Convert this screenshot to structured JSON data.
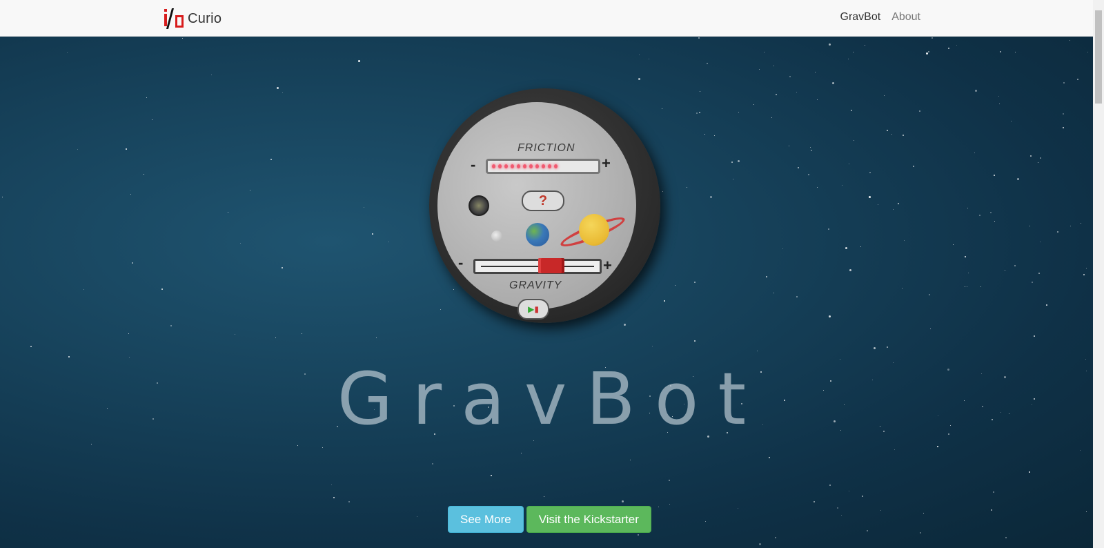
{
  "navbar": {
    "brand_name": "Curio",
    "links": [
      {
        "label": "GravBot",
        "active": true
      },
      {
        "label": "About",
        "active": false
      }
    ]
  },
  "hero": {
    "title": "GravBot",
    "device": {
      "friction_label": "FRICTION",
      "gravity_label": "GRAVITY",
      "minus": "-",
      "plus": "+",
      "question_label": "?",
      "friction_level": 0.7,
      "gravity_level": 0.65
    },
    "buttons": {
      "see_more": "See More",
      "kickstarter": "Visit the Kickstarter"
    }
  },
  "colors": {
    "accent_red": "#d81c1c",
    "info": "#5bc0de",
    "success": "#5cb85c",
    "background": "#17435c"
  }
}
